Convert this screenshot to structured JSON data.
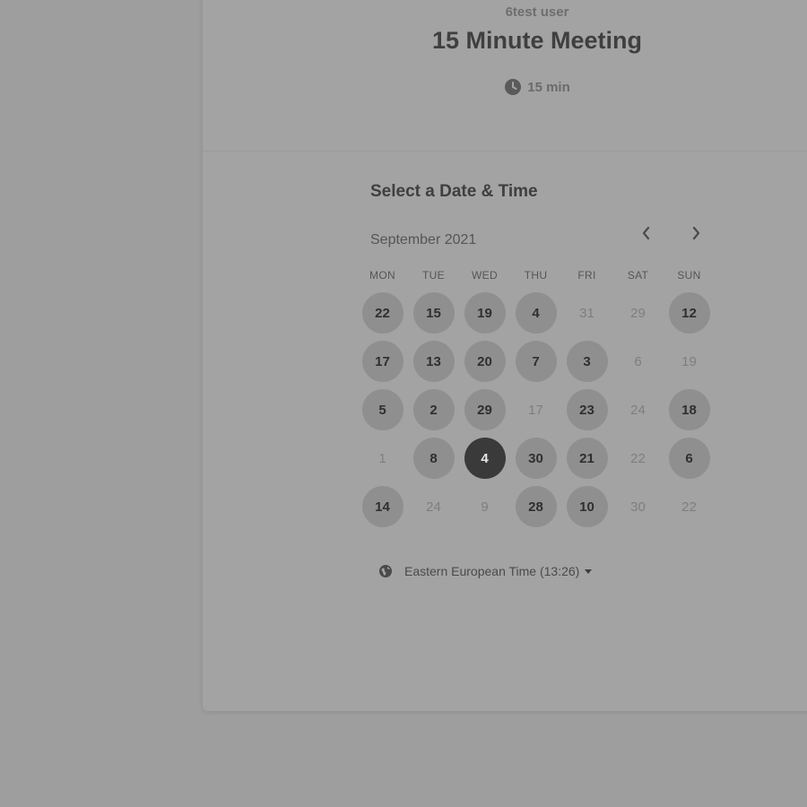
{
  "event": {
    "host": "6test user",
    "title": "15 Minute Meeting",
    "duration": "15 min"
  },
  "picker": {
    "heading": "Select a Date & Time",
    "month": "September 2021",
    "weekdays": [
      "MON",
      "TUE",
      "WED",
      "THU",
      "FRI",
      "SAT",
      "SUN"
    ],
    "weeks": [
      [
        {
          "label": "22",
          "state": "available"
        },
        {
          "label": "15",
          "state": "available"
        },
        {
          "label": "19",
          "state": "available"
        },
        {
          "label": "4",
          "state": "available"
        },
        {
          "label": "31",
          "state": "unavailable"
        },
        {
          "label": "29",
          "state": "unavailable"
        },
        {
          "label": "12",
          "state": "available"
        }
      ],
      [
        {
          "label": "17",
          "state": "available"
        },
        {
          "label": "13",
          "state": "available"
        },
        {
          "label": "20",
          "state": "available"
        },
        {
          "label": "7",
          "state": "available"
        },
        {
          "label": "3",
          "state": "available"
        },
        {
          "label": "6",
          "state": "unavailable"
        },
        {
          "label": "19",
          "state": "unavailable"
        }
      ],
      [
        {
          "label": "5",
          "state": "available"
        },
        {
          "label": "2",
          "state": "available"
        },
        {
          "label": "29",
          "state": "available"
        },
        {
          "label": "17",
          "state": "unavailable"
        },
        {
          "label": "23",
          "state": "available"
        },
        {
          "label": "24",
          "state": "unavailable"
        },
        {
          "label": "18",
          "state": "available"
        }
      ],
      [
        {
          "label": "1",
          "state": "unavailable"
        },
        {
          "label": "8",
          "state": "available"
        },
        {
          "label": "4",
          "state": "selected"
        },
        {
          "label": "30",
          "state": "available"
        },
        {
          "label": "21",
          "state": "available"
        },
        {
          "label": "22",
          "state": "unavailable"
        },
        {
          "label": "6",
          "state": "available"
        }
      ],
      [
        {
          "label": "14",
          "state": "available"
        },
        {
          "label": "24",
          "state": "unavailable"
        },
        {
          "label": "9",
          "state": "unavailable"
        },
        {
          "label": "28",
          "state": "available"
        },
        {
          "label": "10",
          "state": "available"
        },
        {
          "label": "30",
          "state": "unavailable"
        },
        {
          "label": "22",
          "state": "unavailable"
        }
      ]
    ],
    "timezone": "Eastern European Time (13:26)"
  },
  "icons": {
    "duration": "clock-icon",
    "timezone": "globe-icon",
    "timezone_dropdown": "caret-down-icon",
    "prev_month": "chevron-left-icon",
    "next_month": "chevron-right-icon"
  }
}
